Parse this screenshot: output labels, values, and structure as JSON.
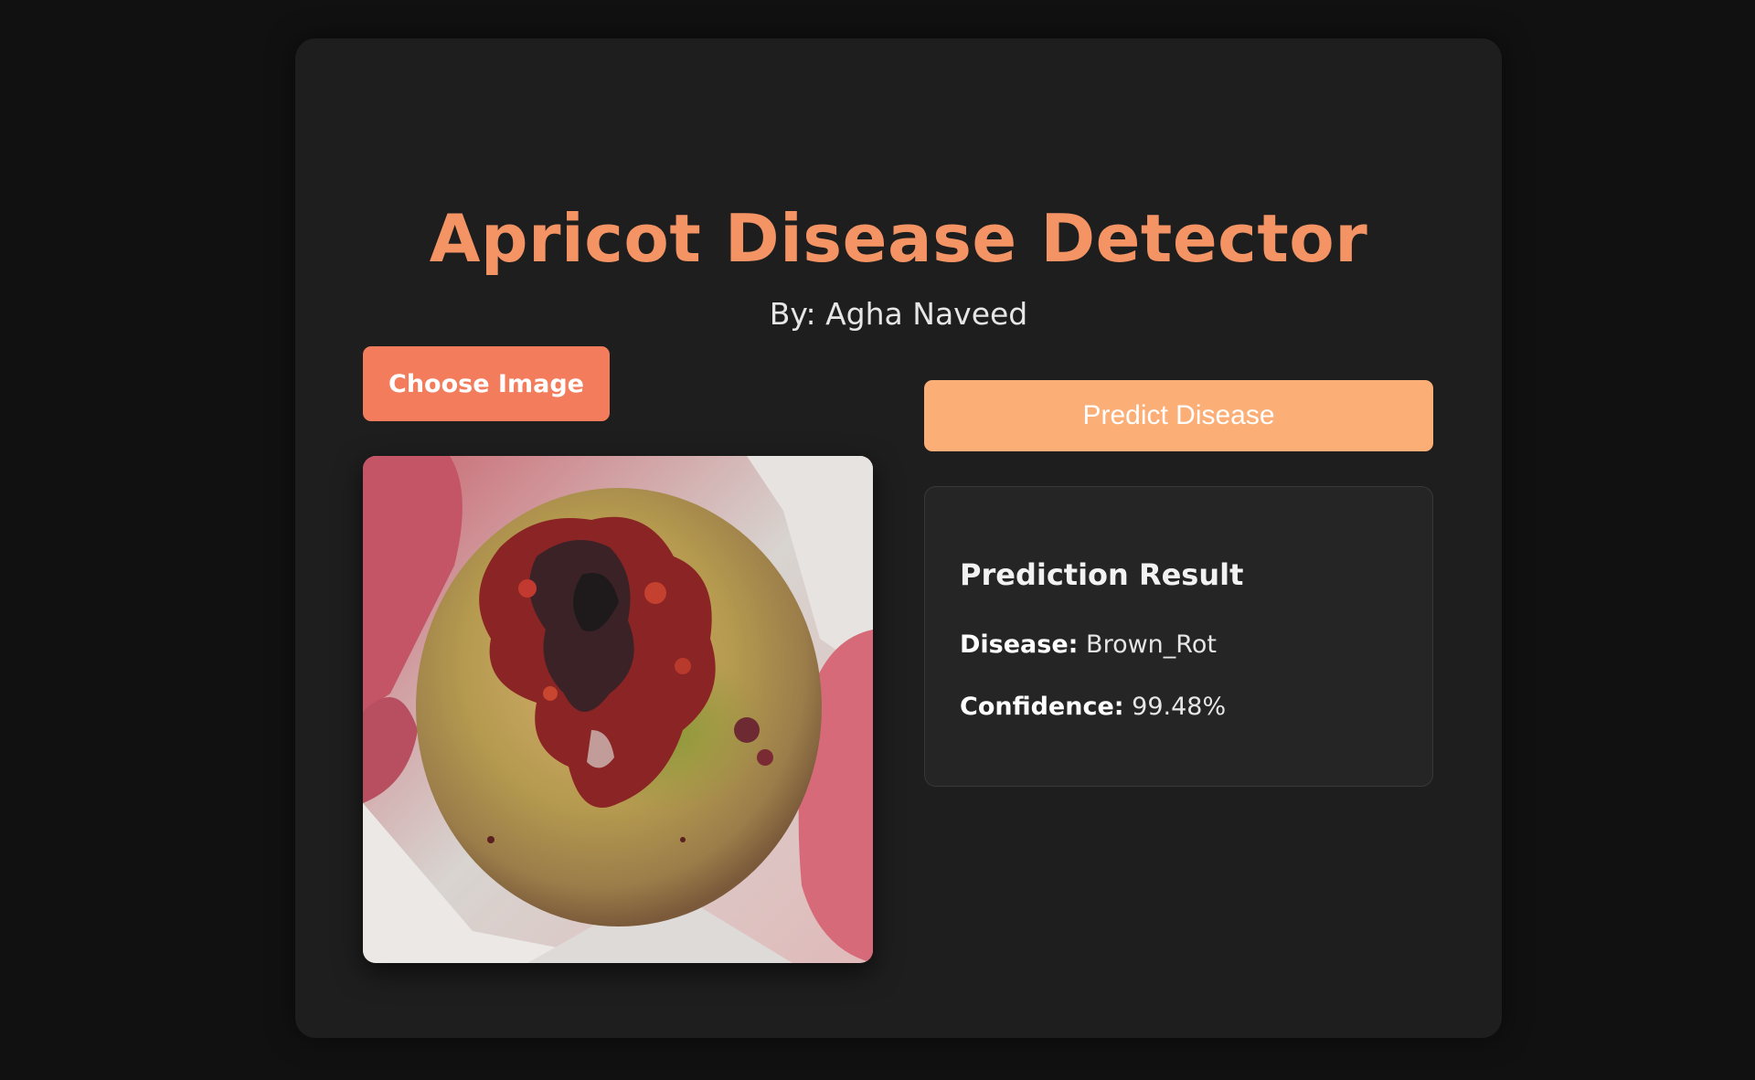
{
  "header": {
    "title": "Apricot Disease Detector",
    "subtitle": "By: Agha Naveed"
  },
  "upload": {
    "choose_label": "Choose Image",
    "image_alt": "uploaded apricot photo"
  },
  "actions": {
    "predict_label": "Predict Disease"
  },
  "result": {
    "heading": "Prediction Result",
    "disease_label": "Disease:",
    "disease_value": "Brown_Rot",
    "confidence_label": "Confidence:",
    "confidence_value": "99.48%"
  },
  "colors": {
    "background": "#111111",
    "card": "#1e1e1e",
    "accent_title": "#f49364",
    "choose_button": "#f27c5b",
    "predict_button": "#fbae76"
  }
}
